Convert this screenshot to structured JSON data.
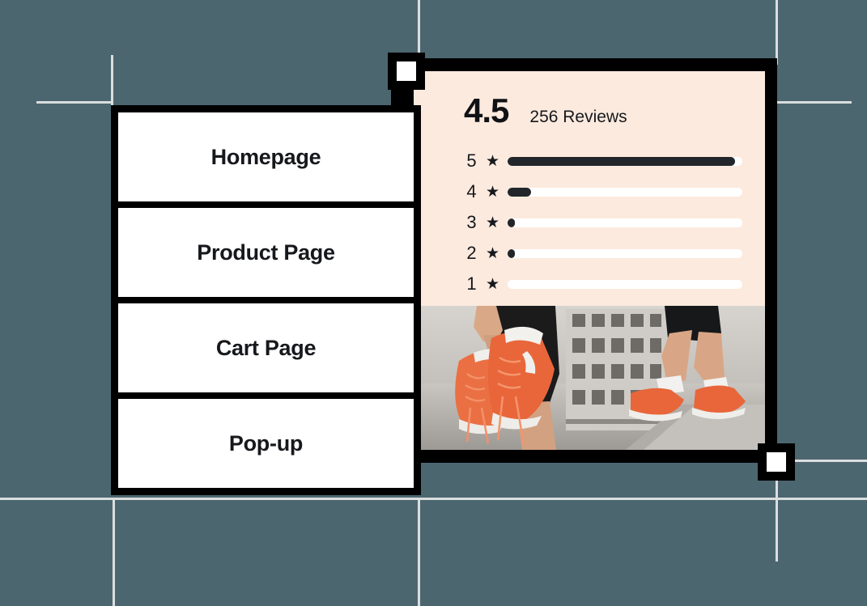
{
  "canvas": {
    "background_color": "#4c6670",
    "guide_color": "#dadedd",
    "frame_color": "#000000"
  },
  "sidebar": {
    "name": "page-list",
    "items": [
      {
        "label": "Homepage"
      },
      {
        "label": "Product Page"
      },
      {
        "label": "Cart Page"
      },
      {
        "label": "Pop-up"
      }
    ]
  },
  "review_card": {
    "background_color": "#fceade",
    "score": "4.5",
    "reviews_count_label": "256 Reviews",
    "star_glyph": "★",
    "bar_track_color": "#ffffff",
    "bar_fill_color": "#22262b",
    "rows": [
      {
        "stars": "5",
        "fill_percent": 97
      },
      {
        "stars": "4",
        "fill_percent": 10
      },
      {
        "stars": "3",
        "fill_percent": 3
      },
      {
        "stars": "2",
        "fill_percent": 3
      },
      {
        "stars": "1",
        "fill_percent": 0
      }
    ]
  },
  "product_photo": {
    "alt": "Person holding a pair of orange running sneakers in front of a city building, second person walking on a ledge wearing the same orange sneakers",
    "accent_color": "#e8663a"
  },
  "handles": [
    {
      "position": "top-left"
    },
    {
      "position": "bottom-right"
    }
  ]
}
